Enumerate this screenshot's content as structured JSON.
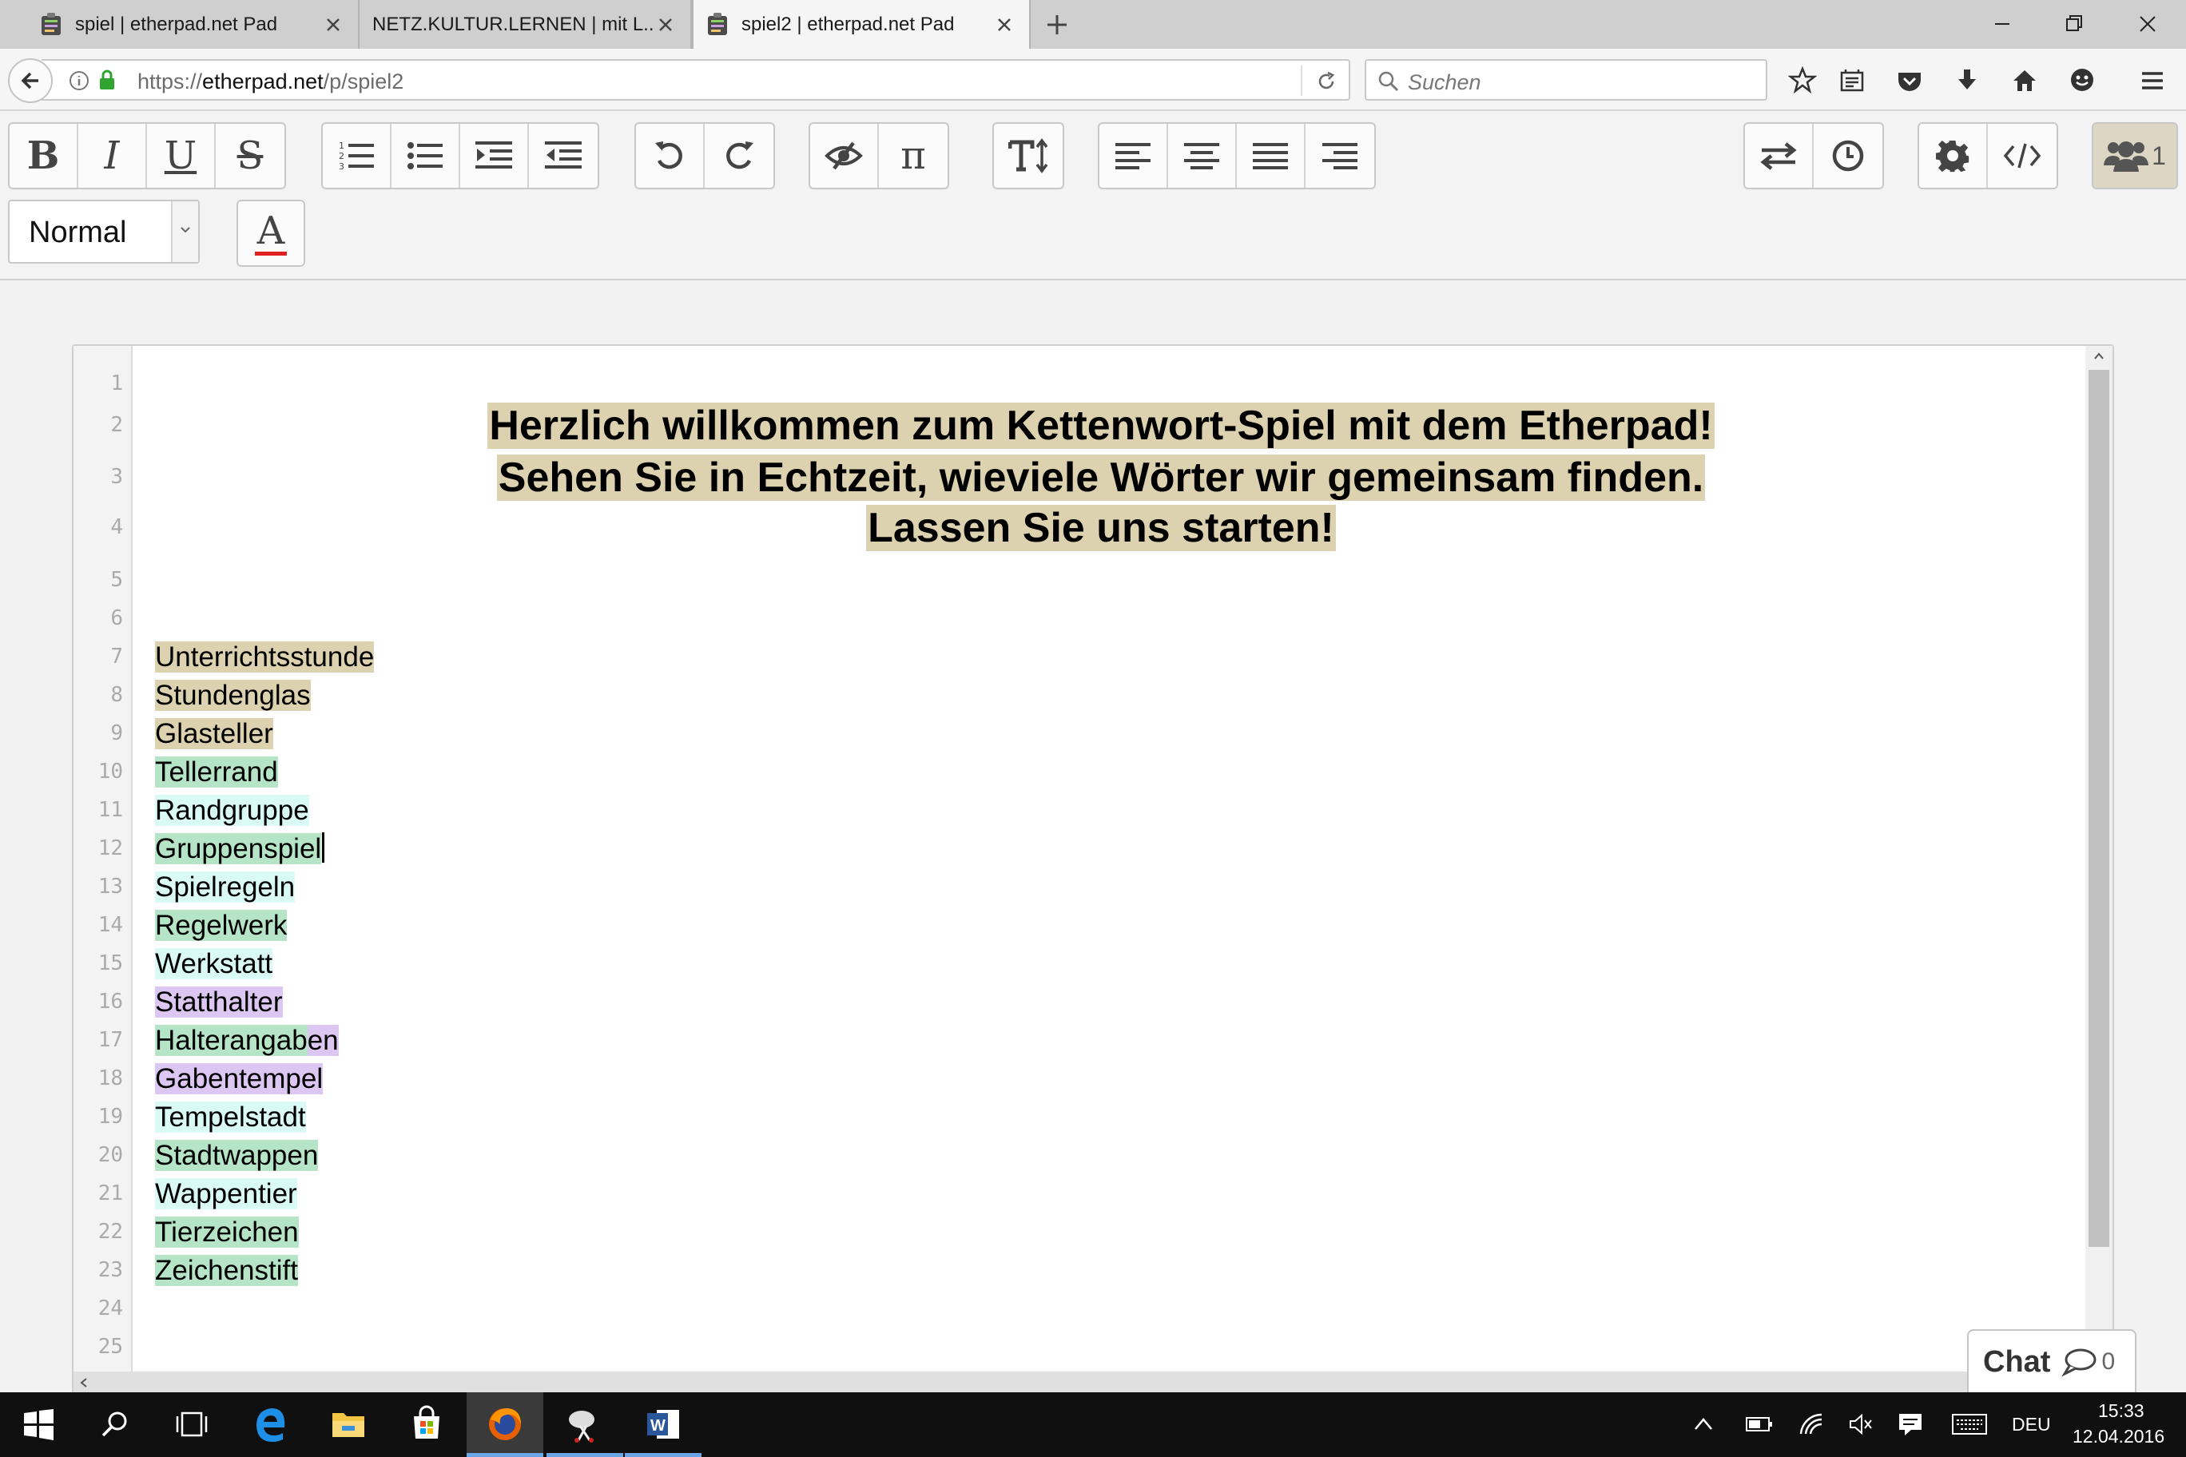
{
  "tabs": [
    {
      "label": "spiel | etherpad.net Pad",
      "active": false
    },
    {
      "label": "NETZ.KULTUR.LERNEN | mit L...",
      "active": false
    },
    {
      "label": "spiel2 | etherpad.net Pad",
      "active": true
    }
  ],
  "address_bar": {
    "scheme": "https://",
    "host": "etherpad.net",
    "path": "/p/spiel2"
  },
  "search": {
    "placeholder": "Suchen"
  },
  "toolbar": {
    "paragraph_style": "Normal",
    "user_count": "1",
    "buttons": [
      "bold",
      "italic",
      "underline",
      "strikethrough",
      "ordered-list",
      "unordered-list",
      "indent",
      "outdent",
      "undo",
      "redo",
      "clear-authorship",
      "formula",
      "font-size",
      "align-left",
      "align-center",
      "align-justify",
      "align-right",
      "import-export",
      "timeslider",
      "settings",
      "embed",
      "users"
    ]
  },
  "editor": {
    "line_numbers": [
      "1",
      "2",
      "3",
      "4",
      "5",
      "6",
      "7",
      "8",
      "9",
      "10",
      "11",
      "12",
      "13",
      "14",
      "15",
      "16",
      "17",
      "18",
      "19",
      "20",
      "21",
      "22",
      "23",
      "24",
      "25"
    ],
    "heading_lines": [
      "Herzlich willkommen zum Kettenwort-Spiel mit dem Etherpad!",
      "Sehen Sie in Echtzeit, wieviele Wörter wir gemeinsam finden.",
      "Lassen Sie uns starten!"
    ],
    "words": [
      "Unterrichtsstunde",
      "Stundenglas",
      "Glasteller",
      "Tellerrand",
      "Randgruppe",
      "Gruppenspiel",
      "Spielregeln",
      "Regelwerk",
      "Werkstatt",
      "Statthalter",
      "Halterangaben",
      "Gabentempel",
      "Tempelstadt",
      "Stadtwappen",
      "Wappentier",
      "Tierzeichen",
      "Zeichenstift"
    ],
    "author_colors": {
      "tan": "#ddd2b0",
      "green": "#b5e4c6",
      "cyan": "#dafaf5",
      "purple": "#dcc6f2"
    }
  },
  "chat": {
    "label": "Chat",
    "count": "0"
  },
  "taskbar": {
    "language": "DEU",
    "time": "15:33",
    "date": "12.04.2016"
  }
}
